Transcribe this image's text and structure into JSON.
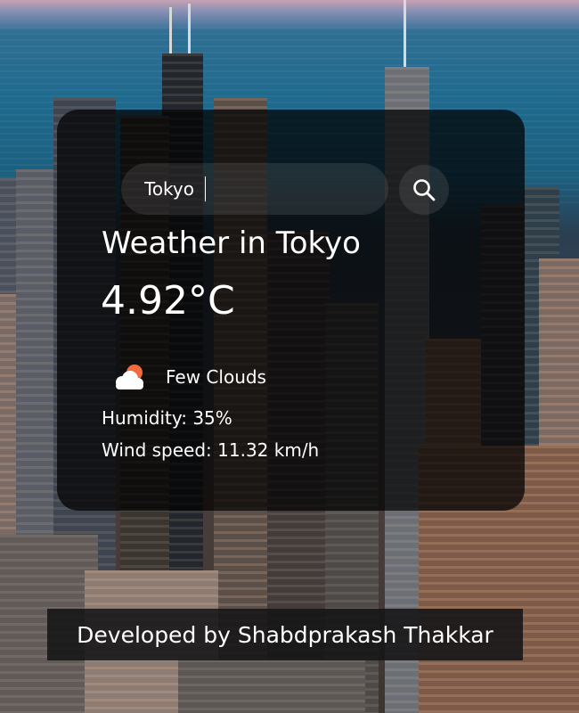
{
  "search": {
    "value": "Tokyo",
    "placeholder": "Search"
  },
  "weather": {
    "title": "Weather in Tokyo",
    "temperature": "4.92°C",
    "icon": "few-clouds-icon",
    "description": "Few Clouds",
    "humidity": "Humidity: 35%",
    "wind": "Wind speed: 11.32 km/h"
  },
  "footer": {
    "credit": "Developed by Shabdprakash Thakkar"
  },
  "colors": {
    "card_background": "#000000",
    "text": "#ffffff",
    "sun": "#f26a3d",
    "cloud": "#ffffff"
  }
}
